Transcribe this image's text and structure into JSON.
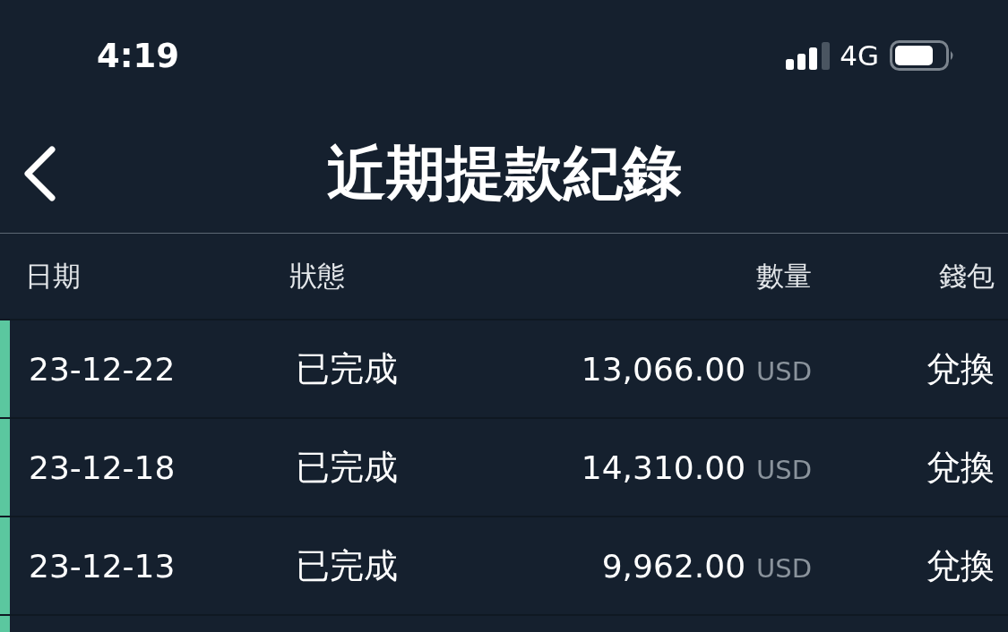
{
  "status_bar": {
    "time": "4:19",
    "network": "4G"
  },
  "nav": {
    "title": "近期提款紀錄"
  },
  "table": {
    "columns": [
      "日期",
      "狀態",
      "數量",
      "錢包"
    ],
    "rows": [
      {
        "date": "23-12-22",
        "status": "已完成",
        "amount": "13,066.00",
        "currency": "USD",
        "wallet": "兌換",
        "color": "#5bc79f"
      },
      {
        "date": "23-12-18",
        "status": "已完成",
        "amount": "14,310.00",
        "currency": "USD",
        "wallet": "兌換",
        "color": "#5bc79f"
      },
      {
        "date": "23-12-13",
        "status": "已完成",
        "amount": "9,962.00",
        "currency": "USD",
        "wallet": "兌換",
        "color": "#5bc79f"
      },
      {
        "color": "#5bc79f"
      }
    ]
  }
}
